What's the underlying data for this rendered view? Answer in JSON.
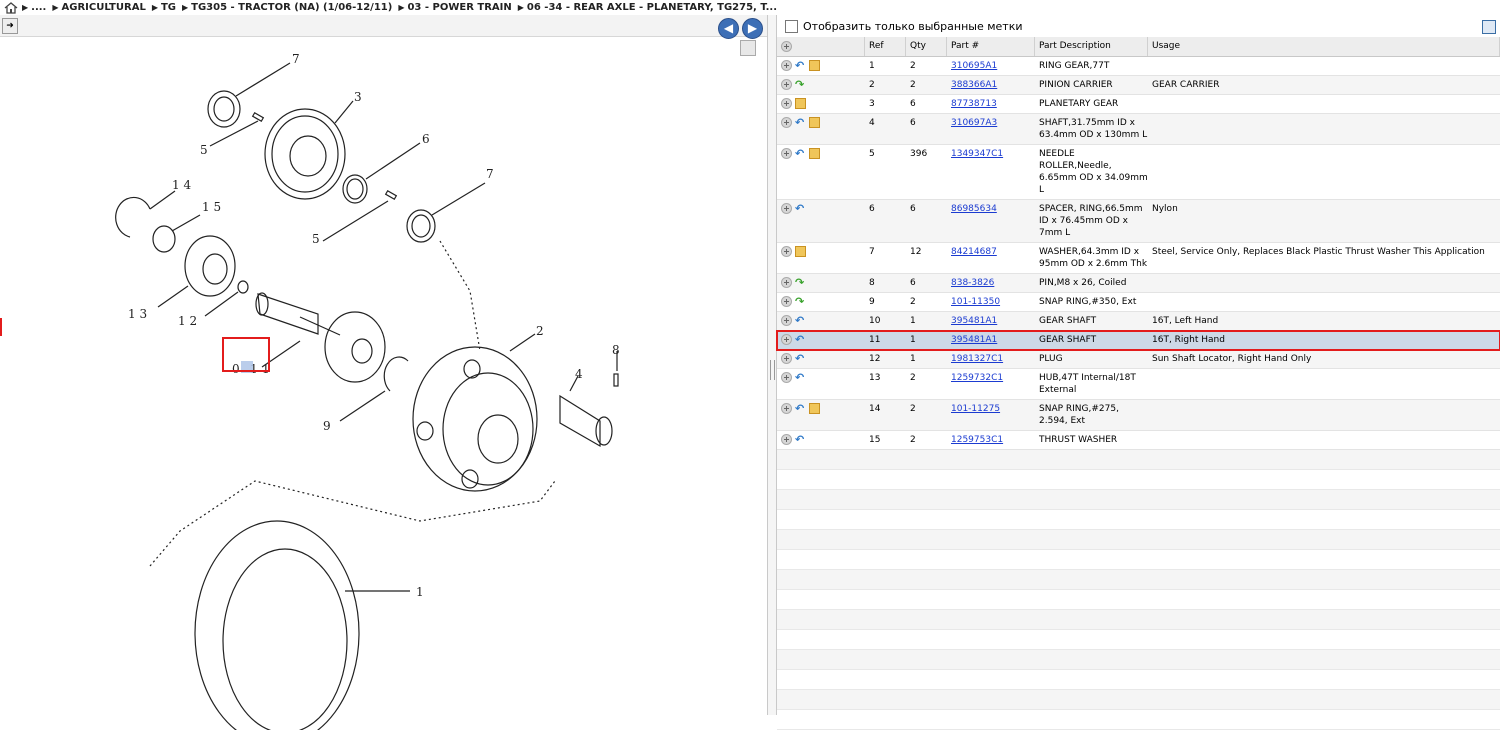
{
  "breadcrumb": {
    "items": [
      "....",
      "AGRICULTURAL",
      "TG",
      "TG305 - TRACTOR (NA) (1/06-12/11)",
      "03 - POWER TRAIN",
      "06 -34 - REAR AXLE - PLANETARY, TG275, T..."
    ]
  },
  "diagram": {
    "labels": [
      "7",
      "3",
      "5",
      "6",
      "7",
      "5",
      "1 4",
      "1 5",
      "1 3",
      "1 2",
      "0",
      "1",
      "1",
      "2",
      "8",
      "4",
      "9",
      "1"
    ]
  },
  "filter": {
    "label": "Отобразить только выбранные метки"
  },
  "table": {
    "columns": [
      "Ref",
      "Qty",
      "Part #",
      "Part Description",
      "Usage"
    ],
    "rows": [
      {
        "icons": [
          "plus",
          "back",
          "box"
        ],
        "ref": "1",
        "qty": "2",
        "part": "310695A1",
        "desc": "RING GEAR,77T",
        "usage": ""
      },
      {
        "icons": [
          "plus",
          "fwd"
        ],
        "ref": "2",
        "qty": "2",
        "part": "388366A1",
        "desc": "PINION CARRIER",
        "usage": "GEAR CARRIER"
      },
      {
        "icons": [
          "plus",
          "box"
        ],
        "ref": "3",
        "qty": "6",
        "part": "87738713",
        "desc": "PLANETARY GEAR",
        "usage": ""
      },
      {
        "icons": [
          "plus",
          "back",
          "box"
        ],
        "ref": "4",
        "qty": "6",
        "part": "310697A3",
        "desc": "SHAFT,31.75mm ID x 63.4mm OD x 130mm L",
        "usage": ""
      },
      {
        "icons": [
          "plus",
          "back",
          "box"
        ],
        "ref": "5",
        "qty": "396",
        "part": "1349347C1",
        "desc": "NEEDLE ROLLER,Needle, 6.65mm OD x 34.09mm L",
        "usage": ""
      },
      {
        "icons": [
          "plus",
          "back"
        ],
        "ref": "6",
        "qty": "6",
        "part": "86985634",
        "desc": "SPACER, RING,66.5mm ID x 76.45mm OD x 7mm L",
        "usage": "Nylon"
      },
      {
        "icons": [
          "plus",
          "box"
        ],
        "ref": "7",
        "qty": "12",
        "part": "84214687",
        "desc": "WASHER,64.3mm ID x 95mm OD x 2.6mm Thk",
        "usage": "Steel, Service Only, Replaces Black Plastic Thrust Washer This Application"
      },
      {
        "icons": [
          "plus",
          "fwd"
        ],
        "ref": "8",
        "qty": "6",
        "part": "838-3826",
        "desc": "PIN,M8 x 26, Coiled",
        "usage": ""
      },
      {
        "icons": [
          "plus",
          "fwd"
        ],
        "ref": "9",
        "qty": "2",
        "part": "101-11350",
        "desc": "SNAP RING,#350, Ext",
        "usage": ""
      },
      {
        "icons": [
          "plus",
          "back"
        ],
        "ref": "10",
        "qty": "1",
        "part": "395481A1",
        "desc": "GEAR SHAFT",
        "usage": "16T, Left Hand"
      },
      {
        "icons": [
          "plus",
          "back"
        ],
        "ref": "11",
        "qty": "1",
        "part": "395481A1",
        "desc": "GEAR SHAFT",
        "usage": "16T, Right Hand",
        "selected": true
      },
      {
        "icons": [
          "plus",
          "back"
        ],
        "ref": "12",
        "qty": "1",
        "part": "1981327C1",
        "desc": "PLUG",
        "usage": "Sun Shaft Locator, Right Hand Only"
      },
      {
        "icons": [
          "plus",
          "back"
        ],
        "ref": "13",
        "qty": "2",
        "part": "1259732C1",
        "desc": "HUB,47T Internal/18T External",
        "usage": ""
      },
      {
        "icons": [
          "plus",
          "back",
          "box"
        ],
        "ref": "14",
        "qty": "2",
        "part": "101-11275",
        "desc": "SNAP RING,#275, 2.594, Ext",
        "usage": ""
      },
      {
        "icons": [
          "plus",
          "back"
        ],
        "ref": "15",
        "qty": "2",
        "part": "1259753C1",
        "desc": "THRUST WASHER",
        "usage": ""
      }
    ]
  },
  "colors": {
    "accent": "#3d6fb6",
    "highlight": "#e31c1c",
    "link": "#1b3bd1",
    "selected_row": "#cdd9e7"
  }
}
